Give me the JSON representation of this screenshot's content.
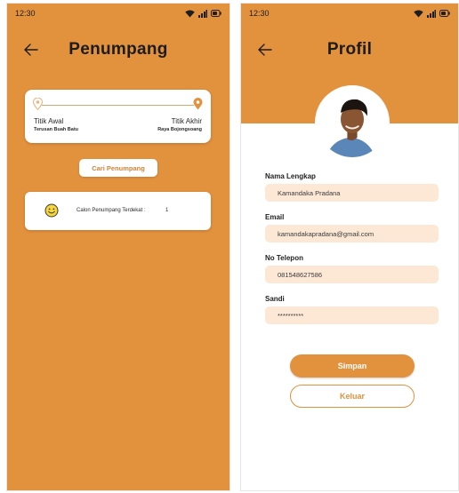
{
  "colors": {
    "accent": "#e2913d",
    "input_background": "#fde8d6",
    "card_background": "#ffffff"
  },
  "left_screen": {
    "status_time": "12:30",
    "title": "Penumpang",
    "back_icon": "arrow-left-icon",
    "route": {
      "start_icon": "location-pin-icon",
      "end_icon": "location-pin-icon",
      "start_label": "Titik Awal",
      "start_place": "Terusan Buah Batu",
      "end_label": "Titik Akhir",
      "end_place": "Raya Bojongsoang"
    },
    "search_button": "Cari Penumpang",
    "nearby": {
      "icon": "smiley-icon",
      "label": "Calon Penumpang Terdekat :",
      "count": "1"
    }
  },
  "right_screen": {
    "status_time": "12:30",
    "title": "Profil",
    "back_icon": "arrow-left-icon",
    "avatar_icon": "profile-photo",
    "fields": [
      {
        "label": "Nama Lengkap",
        "value": "Kamandaka Pradana"
      },
      {
        "label": "Email",
        "value": "kamandakapradana@gmail.com"
      },
      {
        "label": "No Telepon",
        "value": "081548627586"
      },
      {
        "label": "Sandi",
        "value": "**********"
      }
    ],
    "save_button": "Simpan",
    "logout_button": "Keluar"
  }
}
